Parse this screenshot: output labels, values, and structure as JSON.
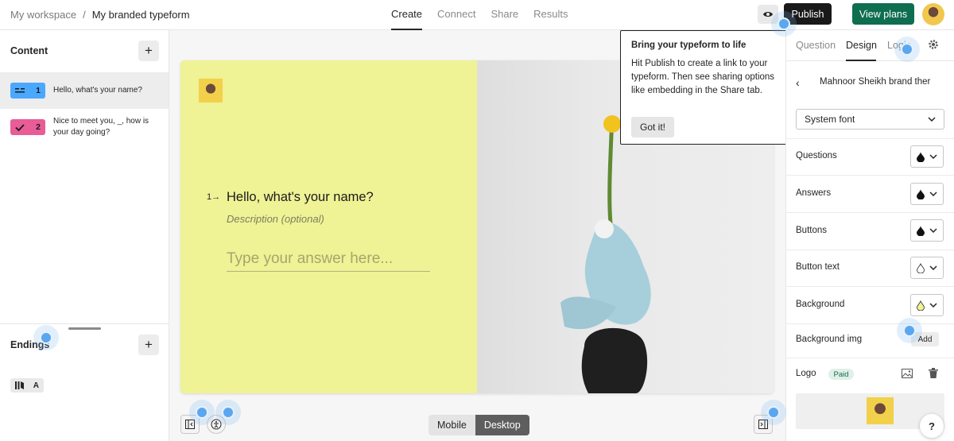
{
  "topbar": {
    "breadcrumb_root": "My workspace",
    "breadcrumb_sep": "/",
    "breadcrumb_current": "My branded typeform",
    "tabs": [
      {
        "label": "Create",
        "active": true
      },
      {
        "label": "Connect",
        "active": false
      },
      {
        "label": "Share",
        "active": false
      },
      {
        "label": "Results",
        "active": false
      }
    ],
    "preview_icon": "eye-icon",
    "publish_label": "Publish",
    "view_plans_label": "View plans"
  },
  "left_panel": {
    "content_header": "Content",
    "questions": [
      {
        "number": "1",
        "text": "Hello, what's your name?",
        "badge_color": "#4ba8ff",
        "icon": "short-text-icon"
      },
      {
        "number": "2",
        "text": "Nice to meet you, _, how is your day going?",
        "badge_color": "#e85c97",
        "icon": "check-icon"
      }
    ],
    "endings_header": "Endings",
    "ending_badge_letter": "A",
    "ending_icon": "ending-icon"
  },
  "canvas": {
    "question_number": "1",
    "question_title": "Hello, what's your name?",
    "question_description": "Description (optional)",
    "answer_placeholder": "Type your answer here...",
    "card_bg_color": "#eff295",
    "device_mobile": "Mobile",
    "device_desktop": "Desktop"
  },
  "tooltip": {
    "title": "Bring your typeform to life",
    "body": "Hit Publish to create a link to your typeform. Then see sharing options like embedding in the Share tab.",
    "button": "Got it!"
  },
  "right_panel": {
    "tabs": [
      "Question",
      "Design",
      "Logic"
    ],
    "active_tab": "Design",
    "theme_name": "Mahnoor Sheikh brand ther",
    "font_select": "System font",
    "color_rows": [
      {
        "label": "Questions",
        "color": "#111111"
      },
      {
        "label": "Answers",
        "color": "#111111"
      },
      {
        "label": "Buttons",
        "color": "#111111"
      },
      {
        "label": "Button text",
        "color": "#ffffff"
      },
      {
        "label": "Background",
        "color": "#eff295"
      }
    ],
    "background_img_label": "Background img",
    "add_label": "Add",
    "logo_label": "Logo",
    "paid_label": "Paid",
    "help_label": "?"
  }
}
